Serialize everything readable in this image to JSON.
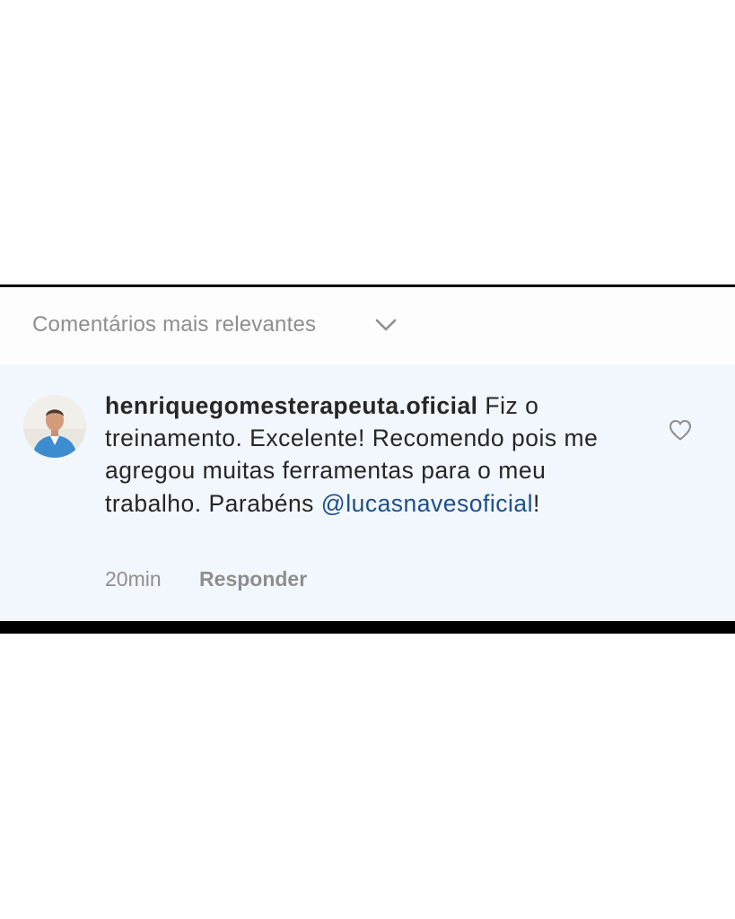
{
  "sort": {
    "label": "Comentários mais relevantes",
    "icon": "chevron-down-icon"
  },
  "comment": {
    "avatar_icon": "avatar",
    "username": "henriquegomesterapeuta.oficial",
    "text_before": " Fiz o treinamento. Excelente! Recomendo pois me agregou muitas ferramentas para o meu trabalho. Parabéns ",
    "mention": "@lucasnavesoficial",
    "text_after": "!",
    "time": "20min",
    "reply_label": "Responder",
    "like_icon": "heart-icon"
  },
  "colors": {
    "text": "#262626",
    "muted": "#8e8e8e",
    "mention": "#1e4f8a",
    "comment_bg": "#f2f7fd"
  }
}
